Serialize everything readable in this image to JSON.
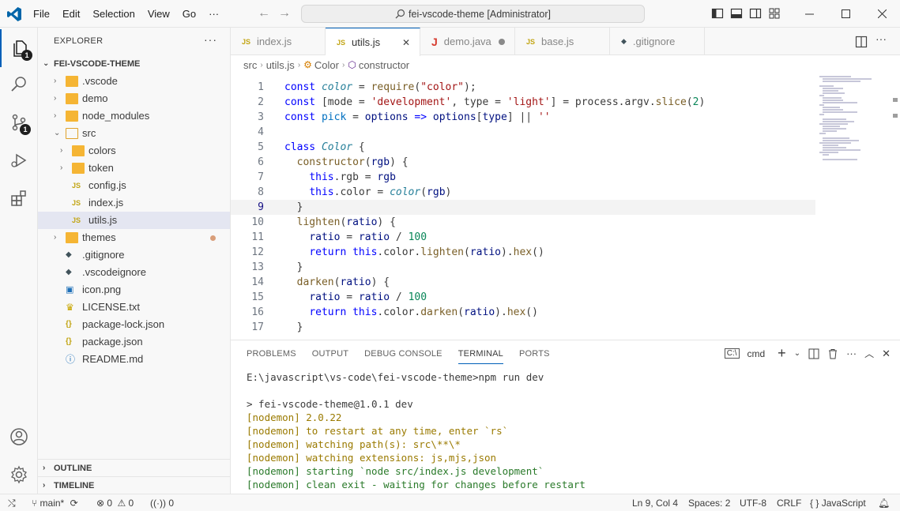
{
  "menu": [
    "File",
    "Edit",
    "Selection",
    "View",
    "Go",
    "···"
  ],
  "command_center": "fei-vscode-theme [Administrator]",
  "activity": {
    "explorer_badge": "1",
    "scm_badge": "1"
  },
  "sidebar": {
    "title": "EXPLORER",
    "more": "···",
    "root": "FEI-VSCODE-THEME",
    "tree": [
      {
        "label": ".vscode",
        "type": "folder",
        "depth": 0,
        "twisty": "›"
      },
      {
        "label": "demo",
        "type": "folder",
        "depth": 0,
        "twisty": "›"
      },
      {
        "label": "node_modules",
        "type": "folder",
        "depth": 0,
        "twisty": "›"
      },
      {
        "label": "src",
        "type": "folder-open",
        "depth": 0,
        "twisty": "⌄"
      },
      {
        "label": "colors",
        "type": "folder",
        "depth": 1,
        "twisty": "›"
      },
      {
        "label": "token",
        "type": "folder",
        "depth": 1,
        "twisty": "›"
      },
      {
        "label": "config.js",
        "type": "js",
        "depth": 1
      },
      {
        "label": "index.js",
        "type": "js",
        "depth": 1
      },
      {
        "label": "utils.js",
        "type": "js",
        "depth": 1,
        "selected": true
      },
      {
        "label": "themes",
        "type": "folder",
        "depth": 0,
        "twisty": "›",
        "modified": true
      },
      {
        "label": ".gitignore",
        "type": "git",
        "depth": 0
      },
      {
        "label": ".vscodeignore",
        "type": "git",
        "depth": 0
      },
      {
        "label": "icon.png",
        "type": "image",
        "depth": 0
      },
      {
        "label": "LICENSE.txt",
        "type": "license",
        "depth": 0
      },
      {
        "label": "package-lock.json",
        "type": "json",
        "depth": 0
      },
      {
        "label": "package.json",
        "type": "json",
        "depth": 0
      },
      {
        "label": "README.md",
        "type": "md",
        "depth": 0
      }
    ],
    "outline": "OUTLINE",
    "timeline": "TIMELINE"
  },
  "tabs": [
    {
      "label": "index.js",
      "icon": "JS",
      "icon_color": "#c2a514"
    },
    {
      "label": "utils.js",
      "icon": "JS",
      "icon_color": "#c2a514",
      "active": true,
      "close": "✕"
    },
    {
      "label": "demo.java",
      "icon": "J",
      "icon_color": "#d63b2f",
      "dirty": true
    },
    {
      "label": "base.js",
      "icon": "JS",
      "icon_color": "#c2a514"
    },
    {
      "label": ".gitignore",
      "icon": "◆",
      "icon_color": "#41535b"
    }
  ],
  "breadcrumbs": [
    "src",
    "utils.js",
    "Color",
    "constructor"
  ],
  "editor": {
    "current_line": 9,
    "lines": [
      [
        [
          "k",
          "const "
        ],
        [
          "c",
          "color"
        ],
        [
          "t",
          " = "
        ],
        [
          "kf",
          "require"
        ],
        [
          "t",
          "("
        ],
        [
          "s",
          "\"color\""
        ],
        [
          "t",
          ");"
        ]
      ],
      [
        [
          "k",
          "const "
        ],
        [
          "t",
          "[mode = "
        ],
        [
          "s",
          "'development'"
        ],
        [
          "t",
          ", type = "
        ],
        [
          "s",
          "'light'"
        ],
        [
          "t",
          "] = process.argv."
        ],
        [
          "kf",
          "slice"
        ],
        [
          "t",
          "("
        ],
        [
          "n",
          "2"
        ],
        [
          "t",
          ")"
        ]
      ],
      [
        [
          "k",
          "const "
        ],
        [
          "p",
          "pick"
        ],
        [
          "t",
          " = "
        ],
        [
          "v",
          "options"
        ],
        [
          "t",
          " "
        ],
        [
          "k",
          "=>"
        ],
        [
          "t",
          " "
        ],
        [
          "v",
          "options"
        ],
        [
          "t",
          "["
        ],
        [
          "v",
          "type"
        ],
        [
          "t",
          "] || "
        ],
        [
          "s",
          "''"
        ]
      ],
      [],
      [
        [
          "k",
          "class "
        ],
        [
          "c",
          "Color"
        ],
        [
          "t",
          " {"
        ]
      ],
      [
        [
          "t",
          "  "
        ],
        [
          "kf",
          "constructor"
        ],
        [
          "t",
          "("
        ],
        [
          "v",
          "rgb"
        ],
        [
          "t",
          ") {"
        ]
      ],
      [
        [
          "t",
          "    "
        ],
        [
          "k",
          "this"
        ],
        [
          "t",
          ".rgb = "
        ],
        [
          "v",
          "rgb"
        ]
      ],
      [
        [
          "t",
          "    "
        ],
        [
          "k",
          "this"
        ],
        [
          "t",
          ".color = "
        ],
        [
          "c",
          "color"
        ],
        [
          "t",
          "("
        ],
        [
          "v",
          "rgb"
        ],
        [
          "t",
          ")"
        ]
      ],
      [
        [
          "t",
          "  }"
        ]
      ],
      [
        [
          "t",
          "  "
        ],
        [
          "kf",
          "lighten"
        ],
        [
          "t",
          "("
        ],
        [
          "v",
          "ratio"
        ],
        [
          "t",
          ") {"
        ]
      ],
      [
        [
          "t",
          "    "
        ],
        [
          "v",
          "ratio"
        ],
        [
          "t",
          " = "
        ],
        [
          "v",
          "ratio"
        ],
        [
          "t",
          " / "
        ],
        [
          "n",
          "100"
        ]
      ],
      [
        [
          "t",
          "    "
        ],
        [
          "k",
          "return "
        ],
        [
          "k",
          "this"
        ],
        [
          "t",
          ".color."
        ],
        [
          "kf",
          "lighten"
        ],
        [
          "t",
          "("
        ],
        [
          "v",
          "ratio"
        ],
        [
          "t",
          ")."
        ],
        [
          "kf",
          "hex"
        ],
        [
          "t",
          "()"
        ]
      ],
      [
        [
          "t",
          "  }"
        ]
      ],
      [
        [
          "t",
          "  "
        ],
        [
          "kf",
          "darken"
        ],
        [
          "t",
          "("
        ],
        [
          "v",
          "ratio"
        ],
        [
          "t",
          ") {"
        ]
      ],
      [
        [
          "t",
          "    "
        ],
        [
          "v",
          "ratio"
        ],
        [
          "t",
          " = "
        ],
        [
          "v",
          "ratio"
        ],
        [
          "t",
          " / "
        ],
        [
          "n",
          "100"
        ]
      ],
      [
        [
          "t",
          "    "
        ],
        [
          "k",
          "return "
        ],
        [
          "k",
          "this"
        ],
        [
          "t",
          ".color."
        ],
        [
          "kf",
          "darken"
        ],
        [
          "t",
          "("
        ],
        [
          "v",
          "ratio"
        ],
        [
          "t",
          ")."
        ],
        [
          "kf",
          "hex"
        ],
        [
          "t",
          "()"
        ]
      ],
      [
        [
          "t",
          "  }"
        ]
      ]
    ]
  },
  "panel": {
    "tabs": [
      "PROBLEMS",
      "OUTPUT",
      "DEBUG CONSOLE",
      "TERMINAL",
      "PORTS"
    ],
    "active_tab": "TERMINAL",
    "shell": "cmd",
    "terminal": [
      {
        "text": "E:\\javascript\\vs-code\\fei-vscode-theme>npm run dev",
        "style": ""
      },
      {
        "text": "",
        "style": ""
      },
      {
        "text": "> fei-vscode-theme@1.0.1 dev",
        "style": ""
      },
      {
        "text": "[nodemon] 2.0.22",
        "style": "y"
      },
      {
        "text": "[nodemon] to restart at any time, enter `rs`",
        "style": "y"
      },
      {
        "text": "[nodemon] watching path(s): src\\**\\*",
        "style": "y"
      },
      {
        "text": "[nodemon] watching extensions: js,mjs,json",
        "style": "y"
      },
      {
        "text": "[nodemon] starting `node src/index.js development`",
        "style": "g"
      },
      {
        "text": "[nodemon] clean exit - waiting for changes before restart",
        "style": "g"
      }
    ]
  },
  "status": {
    "branch": "main*",
    "errors": "0",
    "warnings": "0",
    "ports": "0",
    "position": "Ln 9, Col 4",
    "spaces": "Spaces: 2",
    "encoding": "UTF-8",
    "eol": "CRLF",
    "language": "JavaScript"
  }
}
